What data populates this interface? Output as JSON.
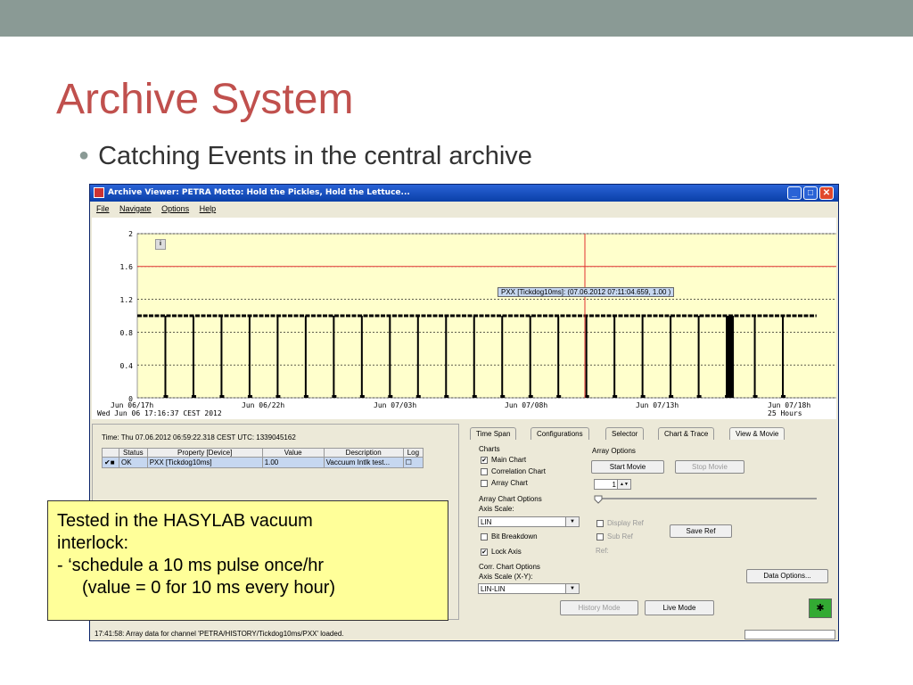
{
  "slide": {
    "title": "Archive System",
    "bullet": "Catching Events in the central archive"
  },
  "window": {
    "title": "Archive Viewer: PETRA     Motto: Hold the Pickles, Hold the Lettuce...",
    "menu": [
      "File",
      "Navigate",
      "Options",
      "Help"
    ]
  },
  "chart_data": {
    "type": "line",
    "title": "",
    "ylim": [
      0,
      2
    ],
    "yticks": [
      "2",
      "1.6",
      "1.2",
      "0.8",
      "0.4",
      "0"
    ],
    "xticks": [
      "Jun 06/17h",
      "Jun 06/22h",
      "Jun 07/03h",
      "Jun 07/08h",
      "Jun 07/13h",
      "Jun 07/18h"
    ],
    "x_start_label": "Wed Jun 06 17:16:37 CEST 2012",
    "x_span_label": "25 Hours",
    "threshold": 1.6,
    "baseline_value": 1.0,
    "pulse_value": 0,
    "pulse_interval_hours": 1,
    "cursor_time": "Jun 07/08h",
    "tooltip": "PXX [Tickdog10ms]: (07.06.2012 07:11:04.659, 1.00 )",
    "info_icon": "i",
    "series": [
      {
        "name": "PXX [Tickdog10ms]"
      }
    ]
  },
  "events": {
    "time_line": "Time: Thu 07.06.2012 06:59:22.318 CEST   UTC: 1339045162",
    "headers": [
      "Status",
      "Property [Device]",
      "Value",
      "Description",
      "Log"
    ],
    "row": {
      "status": "OK",
      "property": "PXX [Tickdog10ms]",
      "value": "1.00",
      "description": "Vaccuum Intlk test..."
    }
  },
  "tabs": [
    "Time Span",
    "Configurations",
    "Selector",
    "Chart & Trace",
    "View & Movie"
  ],
  "charts_group": {
    "label": "Charts",
    "items": [
      "Main Chart",
      "Correlation Chart",
      "Array Chart"
    ]
  },
  "array_chart_options": {
    "label": "Array Chart Options",
    "axis_scale_label": "Axis Scale:",
    "axis_scale": "LIN",
    "bit_breakdown": "Bit Breakdown",
    "lock_axis": "Lock Axis"
  },
  "corr_chart_options": {
    "label": "Corr. Chart Options",
    "axis_scale_label": "Axis Scale (X-Y):",
    "axis_scale": "LIN-LIN"
  },
  "array_options": {
    "label": "Array Options",
    "start_movie": "Start Movie",
    "stop_movie": "Stop Movie",
    "spinner_value": "1",
    "display_ref": "Display Ref",
    "sub_ref": "Sub Ref",
    "save_ref": "Save Ref",
    "ref_label": "Ref:",
    "data_options": "Data Options..."
  },
  "mode_buttons": {
    "history": "History Mode",
    "live": "Live Mode"
  },
  "status": "17:41:58: Array data for channel 'PETRA/HISTORY/Tickdog10ms/PXX' loaded.",
  "callout": {
    "line1": "Tested in the HASYLAB vacuum",
    "line2": "interlock:",
    "line3": "-   ‘schedule a 10 ms pulse once/hr",
    "line4": "(value = 0 for 10 ms every hour)"
  },
  "colors": {
    "title": "#c0504d",
    "topbar": "#8a9a95",
    "plot_bg": "#ffffcc",
    "threshold_line": "#e03030",
    "callout_bg": "#ffff99"
  }
}
